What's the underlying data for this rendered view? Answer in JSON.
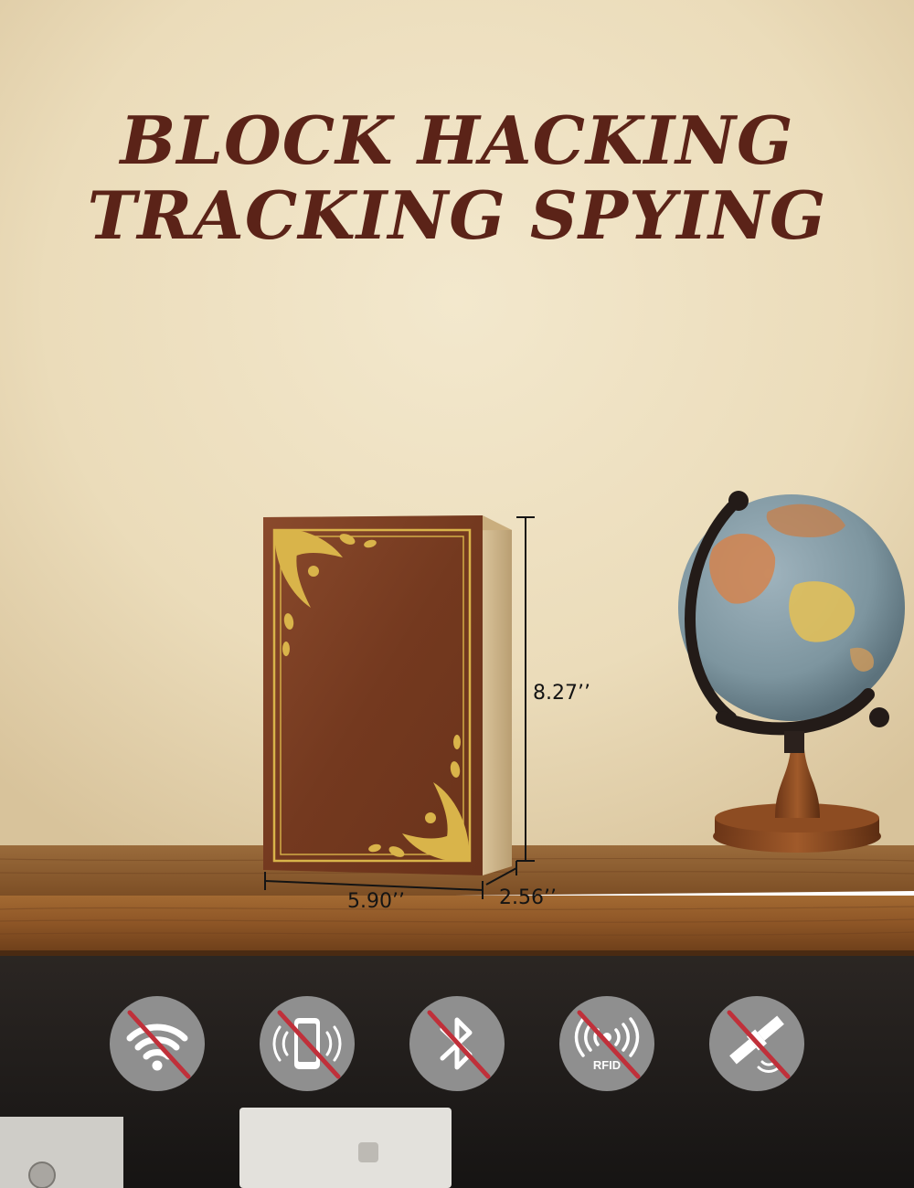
{
  "headline": {
    "line1": "BLOCK HACKING",
    "line2": "TRACKING SPYING"
  },
  "dimensions": {
    "height": "8.27’’",
    "width": "5.90’’",
    "depth": "2.56’’"
  },
  "icons": [
    {
      "name": "wifi-blocked-icon"
    },
    {
      "name": "phone-signal-blocked-icon"
    },
    {
      "name": "bluetooth-blocked-icon"
    },
    {
      "name": "rfid-blocked-icon",
      "label": "RFID"
    },
    {
      "name": "satellite-blocked-icon"
    }
  ],
  "colors": {
    "headline": "#5b2318",
    "wall": "#ece0c2",
    "shelf": "#8a5a2b",
    "book_cover": "#7a3d24",
    "gold_foil": "#d9b44a",
    "icon_circle": "#8f8f8f",
    "strike": "#c0303a"
  }
}
